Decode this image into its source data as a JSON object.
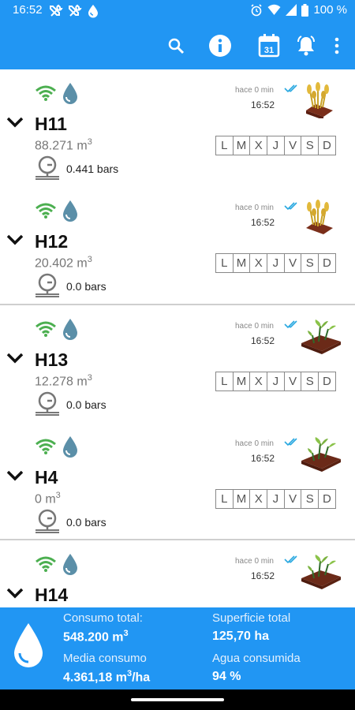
{
  "status_bar": {
    "time": "16:52",
    "battery": "100 %"
  },
  "app_bar": {
    "icons": [
      "search-icon",
      "info-icon",
      "calendar-icon",
      "bell-icon",
      "more-vert-icon"
    ],
    "calendar_day": "31"
  },
  "hydrants": [
    {
      "name": "H11",
      "volume": "88.271 m",
      "volume_unit_sup": "3",
      "pressure": "0.441 bars",
      "last_seen": "hace 0 min",
      "time": "16:52",
      "plant": "wheat"
    },
    {
      "name": "H12",
      "volume": "20.402 m",
      "volume_unit_sup": "3",
      "pressure": "0.0 bars",
      "last_seen": "hace 0 min",
      "time": "16:52",
      "plant": "wheat"
    },
    {
      "name": "H13",
      "volume": "12.278 m",
      "volume_unit_sup": "3",
      "pressure": "0.0 bars",
      "last_seen": "hace 0 min",
      "time": "16:52",
      "plant": "sprout"
    },
    {
      "name": "H4",
      "volume": "0 m",
      "volume_unit_sup": "3",
      "pressure": "0.0 bars",
      "last_seen": "hace 0 min",
      "time": "16:52",
      "plant": "sprout"
    },
    {
      "name": "H14",
      "last_seen": "hace 0 min",
      "time": "16:52",
      "plant": "sprout"
    }
  ],
  "weekdays": [
    "L",
    "M",
    "X",
    "J",
    "V",
    "S",
    "D"
  ],
  "summary": {
    "total_consumption_label": "Consumo total:",
    "total_consumption_value": "548.200 m",
    "total_consumption_sup": "3",
    "total_area_label": "Superficie total",
    "total_area_value": "125,70 ha",
    "avg_consumption_label": "Media consumo",
    "avg_consumption_value": "4.361,18 m",
    "avg_consumption_sup": "3",
    "avg_consumption_suffix": "/ha",
    "water_consumed_label": "Agua consumida",
    "water_consumed_value": "94 %"
  },
  "colors": {
    "primary": "#2196f3",
    "wifi_green": "#4caf50",
    "drop_blue": "#5b8fa8",
    "check_blue": "#29a8e0"
  }
}
